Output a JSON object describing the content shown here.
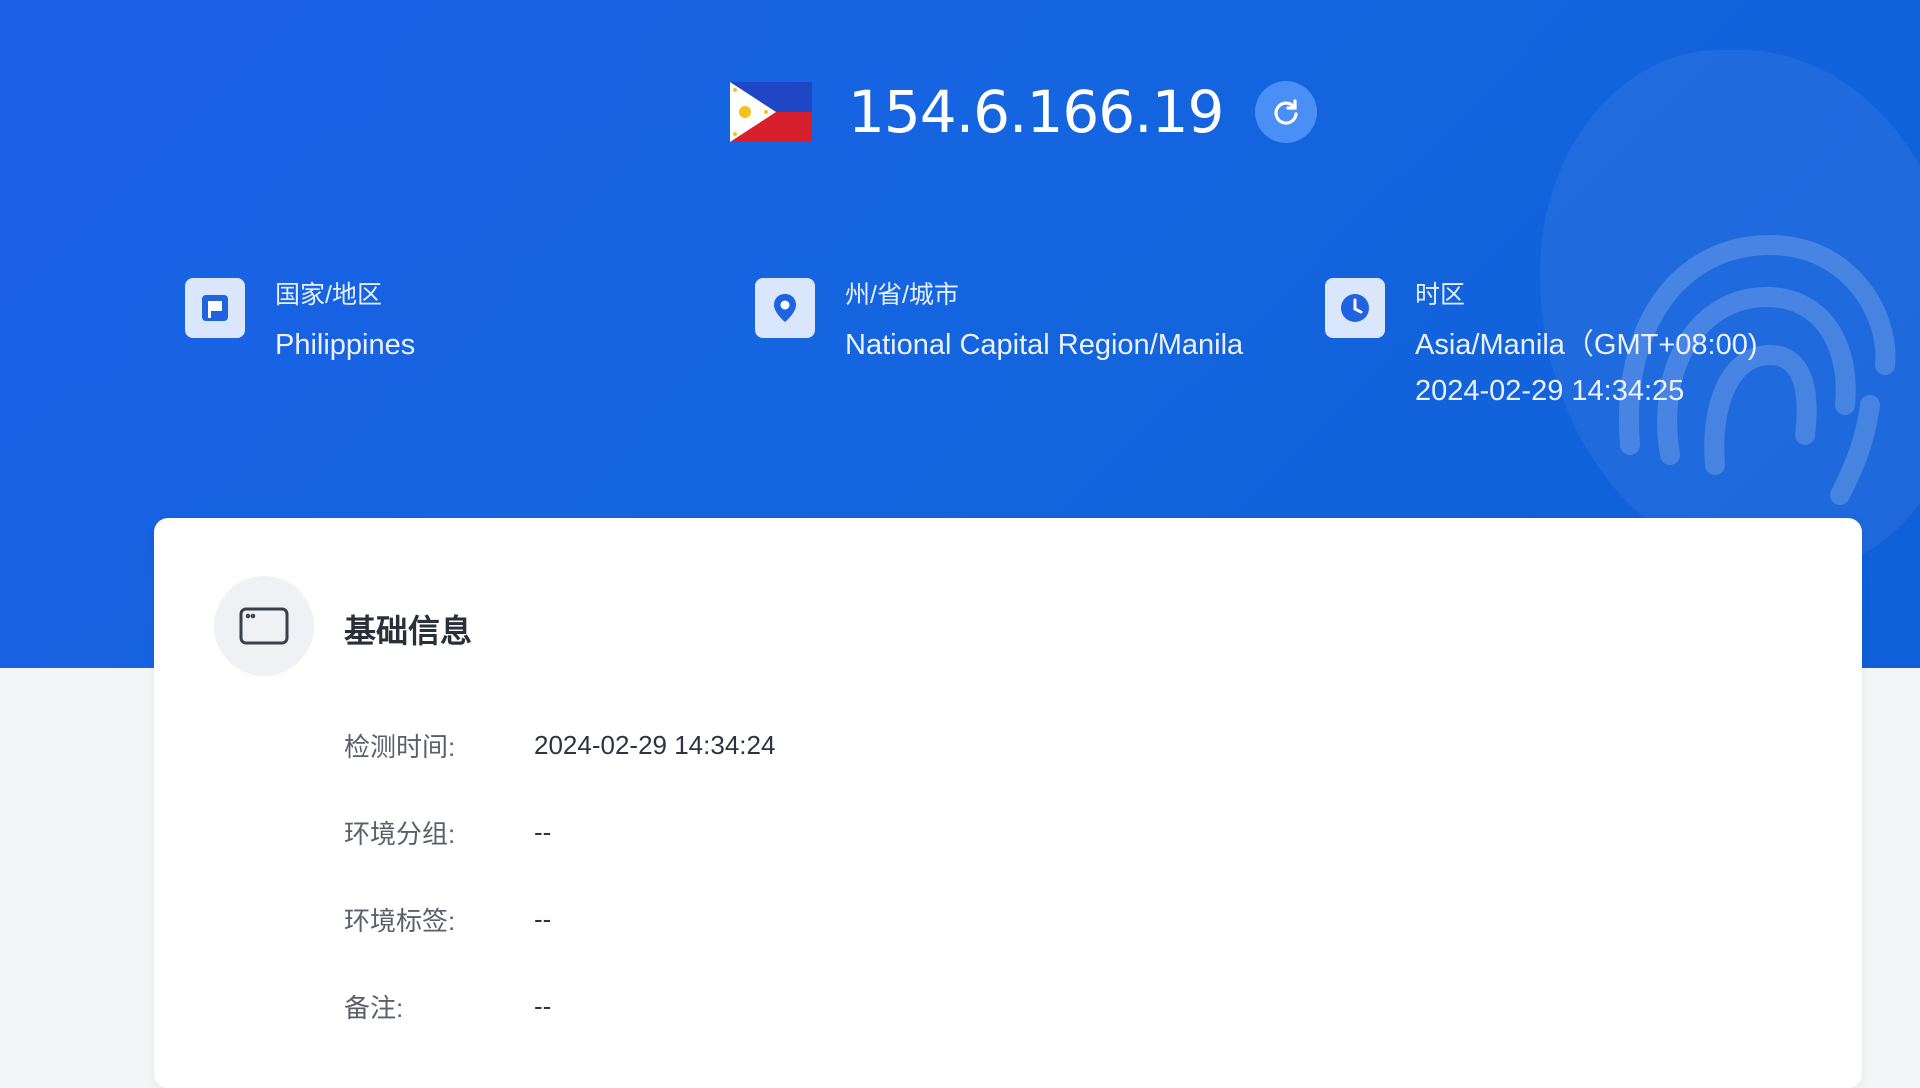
{
  "header": {
    "ip_address": "154.6.166.19",
    "flag": "Philippines flag"
  },
  "info": {
    "country": {
      "icon": "flag-icon",
      "label": "国家/地区",
      "value": "Philippines"
    },
    "region": {
      "icon": "location-pin-icon",
      "label": "州/省/城市",
      "value": "National Capital Region/Manila"
    },
    "timezone": {
      "icon": "clock-icon",
      "label": "时区",
      "value": "Asia/Manila（GMT+08:00)",
      "time": "2024-02-29 14:34:25"
    }
  },
  "basic_info": {
    "title": "基础信息",
    "icon": "browser-window-icon",
    "fields": [
      {
        "label": "检测时间:",
        "value": "2024-02-29 14:34:24"
      },
      {
        "label": "环境分组:",
        "value": "--"
      },
      {
        "label": "环境标签:",
        "value": "--"
      },
      {
        "label": "备注:",
        "value": "--"
      }
    ]
  },
  "colors": {
    "hero_blue": "#1565e0",
    "accent_blue": "#4a8ff5",
    "icon_tile": "#d9e6fc"
  }
}
